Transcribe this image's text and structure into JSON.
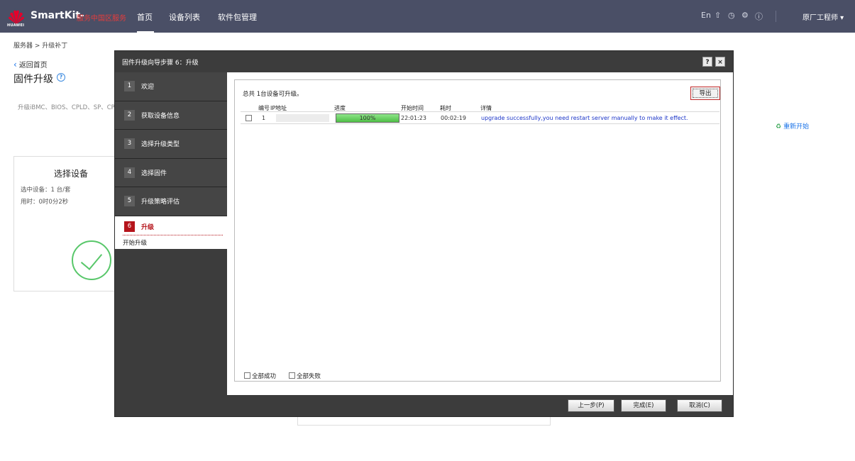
{
  "topbar": {
    "logo_text": "HUAWEI",
    "brand": "SmartKit-",
    "brand_sub": "服务中国区服务",
    "nav": [
      "首页",
      "设备列表",
      "软件包管理"
    ],
    "lang": "En",
    "user": "原厂工程师 ▾",
    "icons": [
      "upload-icon",
      "clock-icon",
      "gear-icon",
      "help-icon"
    ]
  },
  "page": {
    "breadcrumb": "服务器 > 升级补丁",
    "back": "返回首页",
    "title": "固件升级",
    "desc": "升级iBMC、BIOS、CPLD、SP、CPLD等",
    "restart": "重新开始",
    "card": {
      "title": "选择设备",
      "selected": "选中设备：1 台/套",
      "elapsed": "用时：0时0分2秒"
    }
  },
  "dialog": {
    "title": "固件升级向导步骤 6：升级",
    "help": "?",
    "close": "×",
    "steps": [
      {
        "num": "1",
        "label": "欢迎"
      },
      {
        "num": "2",
        "label": "获取设备信息"
      },
      {
        "num": "3",
        "label": "选择升级类型"
      },
      {
        "num": "4",
        "label": "选择固件"
      },
      {
        "num": "5",
        "label": "升级策略评估"
      },
      {
        "num": "6",
        "label": "升级",
        "sub": "开始升级"
      }
    ],
    "summary": "总共 1台设备可升级。",
    "export": "导出",
    "columns": {
      "num": "编号",
      "ip": "IP地址",
      "progress": "进度",
      "start": "开始时间",
      "duration": "耗时",
      "detail": "详情"
    },
    "rows": [
      {
        "num": "1",
        "progress": 100,
        "progress_text": "100%",
        "start": "22:01:23",
        "duration": "00:02:19",
        "detail": "upgrade successfully,you need restart server manually to make it effect."
      }
    ],
    "filters": {
      "success": "全部成功",
      "fail": "全部失败"
    },
    "buttons": {
      "prev": "上一步(P)",
      "finish": "完成(E)",
      "cancel": "取消(C)"
    }
  },
  "colors": {
    "accent": "#b5141b",
    "topbar": "#4a4f66",
    "progress": "#4fbf46",
    "link": "#1a73e8"
  }
}
